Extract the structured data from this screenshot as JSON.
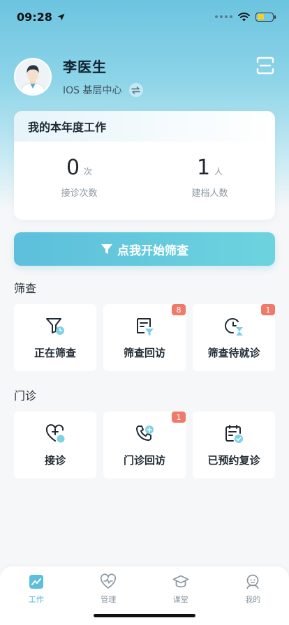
{
  "status_bar": {
    "time": "09:28"
  },
  "profile": {
    "name": "李医生",
    "organization": "IOS 基层中心"
  },
  "work_card": {
    "title": "我的本年度工作",
    "stats": [
      {
        "value": "0",
        "unit": "次",
        "label": "接诊次数"
      },
      {
        "value": "1",
        "unit": "人",
        "label": "建档人数"
      }
    ]
  },
  "start_screening_button": {
    "label": "点我开始筛查"
  },
  "screening_section": {
    "title": "筛查",
    "tiles": [
      {
        "label": "正在筛查",
        "badge": "",
        "icon": "filter-clock-icon"
      },
      {
        "label": "筛查回访",
        "badge": "8",
        "icon": "document-filter-icon"
      },
      {
        "label": "筛查待就诊",
        "badge": "1",
        "icon": "timer-hourglass-icon"
      }
    ]
  },
  "clinic_section": {
    "title": "门诊",
    "tiles": [
      {
        "label": "接诊",
        "badge": "",
        "icon": "heart-add-icon"
      },
      {
        "label": "门诊回访",
        "badge": "1",
        "icon": "phone-add-icon"
      },
      {
        "label": "已预约复诊",
        "badge": "",
        "icon": "calendar-check-icon"
      }
    ]
  },
  "tabbar": {
    "tabs": [
      {
        "label": "工作",
        "icon": "chart-icon",
        "active": true
      },
      {
        "label": "管理",
        "icon": "heart-pulse-icon",
        "active": false
      },
      {
        "label": "课堂",
        "icon": "graduation-cap-icon",
        "active": false
      },
      {
        "label": "我的",
        "icon": "person-icon",
        "active": false
      }
    ]
  },
  "colors": {
    "accent": "#5dbfdc",
    "badge": "#f07a6a",
    "active_tab": "#4fb4d4"
  }
}
